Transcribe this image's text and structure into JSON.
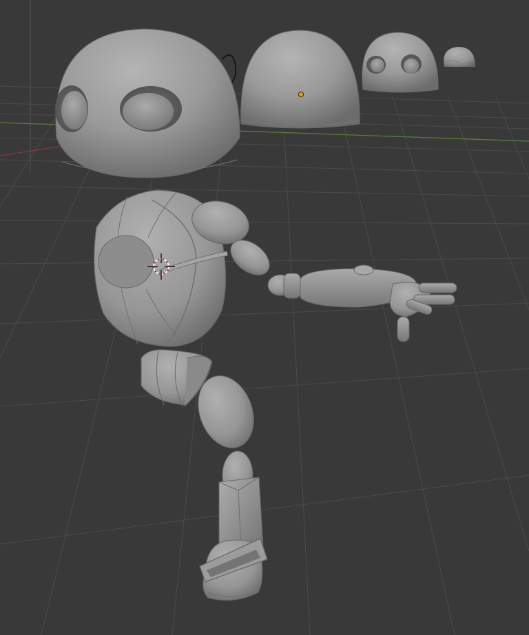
{
  "viewport": {
    "background_color": "#393939",
    "grid_color": "#4a4a4a",
    "x_axis_color": "#8a3a3a",
    "y_axis_color": "#5a7d3a",
    "model_color": "#9a9a9a",
    "selection_color": "#e8a020",
    "cursor_red": "#d23030",
    "cursor_white": "#ffffff"
  },
  "scene_objects": [
    "head-large",
    "head-dome",
    "head-small",
    "head-tiny",
    "torso",
    "shoulder",
    "upper-arm",
    "forearm",
    "hand",
    "thigh",
    "knee",
    "shin",
    "boot"
  ],
  "icons": {
    "cursor": "3d-cursor-icon",
    "origin": "origin-point-icon",
    "light": "light-object-icon"
  }
}
